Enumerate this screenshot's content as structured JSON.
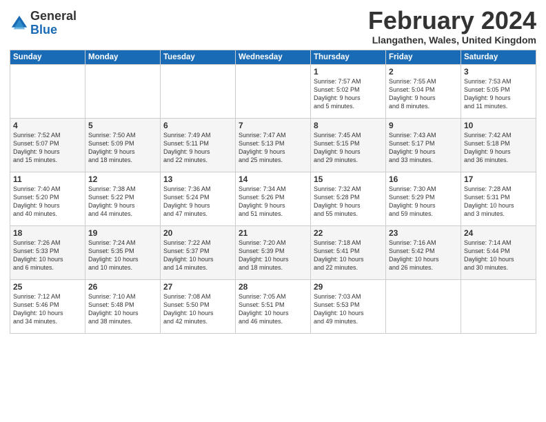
{
  "header": {
    "logo_text_general": "General",
    "logo_text_blue": "Blue",
    "month_title": "February 2024",
    "location": "Llangathen, Wales, United Kingdom"
  },
  "days_of_week": [
    "Sunday",
    "Monday",
    "Tuesday",
    "Wednesday",
    "Thursday",
    "Friday",
    "Saturday"
  ],
  "weeks": [
    [
      {
        "day": "",
        "info": ""
      },
      {
        "day": "",
        "info": ""
      },
      {
        "day": "",
        "info": ""
      },
      {
        "day": "",
        "info": ""
      },
      {
        "day": "1",
        "info": "Sunrise: 7:57 AM\nSunset: 5:02 PM\nDaylight: 9 hours\nand 5 minutes."
      },
      {
        "day": "2",
        "info": "Sunrise: 7:55 AM\nSunset: 5:04 PM\nDaylight: 9 hours\nand 8 minutes."
      },
      {
        "day": "3",
        "info": "Sunrise: 7:53 AM\nSunset: 5:05 PM\nDaylight: 9 hours\nand 11 minutes."
      }
    ],
    [
      {
        "day": "4",
        "info": "Sunrise: 7:52 AM\nSunset: 5:07 PM\nDaylight: 9 hours\nand 15 minutes."
      },
      {
        "day": "5",
        "info": "Sunrise: 7:50 AM\nSunset: 5:09 PM\nDaylight: 9 hours\nand 18 minutes."
      },
      {
        "day": "6",
        "info": "Sunrise: 7:49 AM\nSunset: 5:11 PM\nDaylight: 9 hours\nand 22 minutes."
      },
      {
        "day": "7",
        "info": "Sunrise: 7:47 AM\nSunset: 5:13 PM\nDaylight: 9 hours\nand 25 minutes."
      },
      {
        "day": "8",
        "info": "Sunrise: 7:45 AM\nSunset: 5:15 PM\nDaylight: 9 hours\nand 29 minutes."
      },
      {
        "day": "9",
        "info": "Sunrise: 7:43 AM\nSunset: 5:17 PM\nDaylight: 9 hours\nand 33 minutes."
      },
      {
        "day": "10",
        "info": "Sunrise: 7:42 AM\nSunset: 5:18 PM\nDaylight: 9 hours\nand 36 minutes."
      }
    ],
    [
      {
        "day": "11",
        "info": "Sunrise: 7:40 AM\nSunset: 5:20 PM\nDaylight: 9 hours\nand 40 minutes."
      },
      {
        "day": "12",
        "info": "Sunrise: 7:38 AM\nSunset: 5:22 PM\nDaylight: 9 hours\nand 44 minutes."
      },
      {
        "day": "13",
        "info": "Sunrise: 7:36 AM\nSunset: 5:24 PM\nDaylight: 9 hours\nand 47 minutes."
      },
      {
        "day": "14",
        "info": "Sunrise: 7:34 AM\nSunset: 5:26 PM\nDaylight: 9 hours\nand 51 minutes."
      },
      {
        "day": "15",
        "info": "Sunrise: 7:32 AM\nSunset: 5:28 PM\nDaylight: 9 hours\nand 55 minutes."
      },
      {
        "day": "16",
        "info": "Sunrise: 7:30 AM\nSunset: 5:29 PM\nDaylight: 9 hours\nand 59 minutes."
      },
      {
        "day": "17",
        "info": "Sunrise: 7:28 AM\nSunset: 5:31 PM\nDaylight: 10 hours\nand 3 minutes."
      }
    ],
    [
      {
        "day": "18",
        "info": "Sunrise: 7:26 AM\nSunset: 5:33 PM\nDaylight: 10 hours\nand 6 minutes."
      },
      {
        "day": "19",
        "info": "Sunrise: 7:24 AM\nSunset: 5:35 PM\nDaylight: 10 hours\nand 10 minutes."
      },
      {
        "day": "20",
        "info": "Sunrise: 7:22 AM\nSunset: 5:37 PM\nDaylight: 10 hours\nand 14 minutes."
      },
      {
        "day": "21",
        "info": "Sunrise: 7:20 AM\nSunset: 5:39 PM\nDaylight: 10 hours\nand 18 minutes."
      },
      {
        "day": "22",
        "info": "Sunrise: 7:18 AM\nSunset: 5:41 PM\nDaylight: 10 hours\nand 22 minutes."
      },
      {
        "day": "23",
        "info": "Sunrise: 7:16 AM\nSunset: 5:42 PM\nDaylight: 10 hours\nand 26 minutes."
      },
      {
        "day": "24",
        "info": "Sunrise: 7:14 AM\nSunset: 5:44 PM\nDaylight: 10 hours\nand 30 minutes."
      }
    ],
    [
      {
        "day": "25",
        "info": "Sunrise: 7:12 AM\nSunset: 5:46 PM\nDaylight: 10 hours\nand 34 minutes."
      },
      {
        "day": "26",
        "info": "Sunrise: 7:10 AM\nSunset: 5:48 PM\nDaylight: 10 hours\nand 38 minutes."
      },
      {
        "day": "27",
        "info": "Sunrise: 7:08 AM\nSunset: 5:50 PM\nDaylight: 10 hours\nand 42 minutes."
      },
      {
        "day": "28",
        "info": "Sunrise: 7:05 AM\nSunset: 5:51 PM\nDaylight: 10 hours\nand 46 minutes."
      },
      {
        "day": "29",
        "info": "Sunrise: 7:03 AM\nSunset: 5:53 PM\nDaylight: 10 hours\nand 49 minutes."
      },
      {
        "day": "",
        "info": ""
      },
      {
        "day": "",
        "info": ""
      }
    ]
  ]
}
